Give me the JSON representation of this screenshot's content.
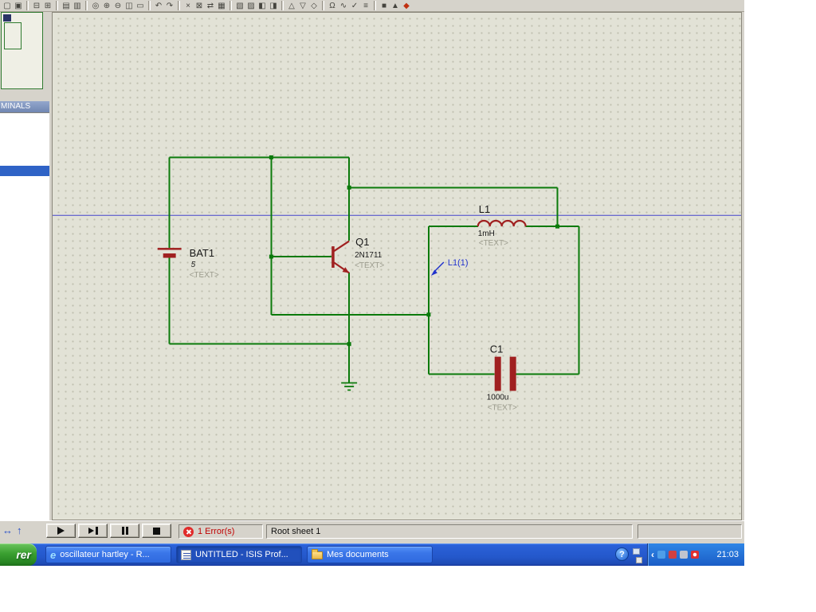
{
  "toolbar": {
    "icons": [
      "▢",
      "▣",
      "⊟",
      "⊞",
      "▤",
      "▥",
      "◎",
      "⊕",
      "⊖",
      "◫",
      "▭",
      "↶",
      "↷",
      "×",
      "⊠",
      "⇄",
      "▦",
      "▧",
      "▨",
      "◧",
      "◨",
      "△",
      "▽",
      "◇",
      "Ω",
      "∿",
      "✓",
      "≡",
      "■",
      "▲",
      "◆"
    ]
  },
  "sidebar": {
    "selector_header": "MINALS"
  },
  "circuit": {
    "battery": {
      "ref": "BAT1",
      "value": "5",
      "placeholder": "<TEXT>"
    },
    "transistor": {
      "ref": "Q1",
      "value": "2N1711",
      "placeholder": "<TEXT>"
    },
    "inductor": {
      "ref": "L1",
      "value": "1mH",
      "placeholder": "<TEXT>"
    },
    "capacitor": {
      "ref": "C1",
      "value": "1000u",
      "placeholder": "<TEXT>"
    },
    "probe": {
      "label": "L1(1)"
    }
  },
  "bottombar": {
    "nav_icons": [
      "↔",
      "↑"
    ],
    "errors": "1 Error(s)",
    "status": "Root sheet 1"
  },
  "taskbar": {
    "start_fragment": "rer",
    "tasks": [
      {
        "icon": "e",
        "label": "oscillateur hartley - R..."
      },
      {
        "icon": "",
        "label": "UNTITLED - ISIS Prof..."
      },
      {
        "icon": "",
        "label": "Mes documents"
      }
    ],
    "help_icon": "?",
    "tray_chevron": "‹",
    "clock": "21:03"
  },
  "colors": {
    "wire": "#0B7A0B",
    "component": "#A02020",
    "probe": "#2233CC",
    "sheet_line": "#4444CC"
  }
}
